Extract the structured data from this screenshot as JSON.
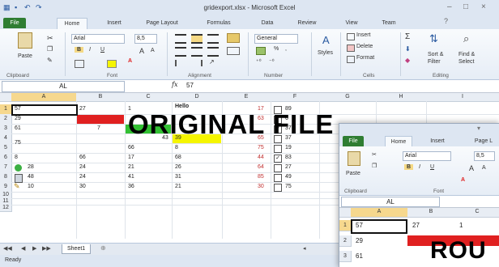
{
  "window": {
    "title": "gridexport.xlsx - Microsoft Excel",
    "qat": [
      "save-icon",
      "undo-icon",
      "redo-icon"
    ],
    "controls": [
      "–",
      "□",
      "×"
    ]
  },
  "tabs": [
    {
      "label": "File"
    },
    {
      "label": "Home"
    },
    {
      "label": "Insert"
    },
    {
      "label": "Page Layout"
    },
    {
      "label": "Formulas"
    },
    {
      "label": "Data"
    },
    {
      "label": "Review"
    },
    {
      "label": "View"
    },
    {
      "label": "Team"
    }
  ],
  "ribbon": {
    "clipboard": {
      "paste": "Paste",
      "label": "Clipboard"
    },
    "font": {
      "name": "Arial",
      "size": "8,5",
      "label": "Font",
      "bold": "B",
      "italic": "I",
      "underline": "U",
      "grow": "A",
      "shrink": "A"
    },
    "alignment": {
      "label": "Alignment"
    },
    "number": {
      "format": "General",
      "label": "Number",
      "pct": "%",
      "comma": ","
    },
    "styles": {
      "label": "Styles"
    },
    "cells": {
      "insert": "Insert",
      "delete": "Delete",
      "format": "Format",
      "label": "Cells"
    },
    "editing": {
      "sum": "Σ",
      "sort": "Sort &",
      "sort2": "Filter",
      "find": "Find &",
      "find2": "Select",
      "label": "Editing"
    }
  },
  "formula_bar": {
    "name_box": "AL",
    "fx": "fx",
    "value": "57"
  },
  "columns": [
    "A",
    "B",
    "C",
    "D",
    "E",
    "F",
    "G",
    "H",
    "I"
  ],
  "rows": [
    "1",
    "2",
    "3",
    "4",
    "5",
    "6",
    "7",
    "8",
    "9",
    "10",
    "11",
    "12"
  ],
  "cells": {
    "r1": {
      "a": "57",
      "b": "27",
      "c": "1",
      "d": "Hello",
      "e": "",
      "f_num": "17",
      "f_chk": "",
      "f_val": "89"
    },
    "r2": {
      "a": "29",
      "b": "",
      "c": "",
      "d": "",
      "f_num": "63",
      "f_val": "6"
    },
    "r3": {
      "a": "61",
      "b": "7",
      "c": "",
      "d": "",
      "f_num": "",
      "f_val": "37"
    },
    "r4": {
      "a": "75",
      "c": "43",
      "d": "39",
      "f_num": "65",
      "f_val": "37"
    },
    "r5": {
      "c": "66",
      "d": "8",
      "f_num": "75",
      "f_val": "19"
    },
    "r6": {
      "a": "8",
      "b": "66",
      "c": "17",
      "d": "68",
      "f_num": "44",
      "f_val": "83"
    },
    "r7": {
      "a": "28",
      "b": "24",
      "c": "21",
      "d": "26",
      "f_num": "64",
      "f_val": "27"
    },
    "r8": {
      "a": "48",
      "b": "24",
      "c": "41",
      "d": "31",
      "f_num": "85",
      "f_val": "49"
    },
    "r9": {
      "a": "10",
      "b": "30",
      "c": "36",
      "d": "21",
      "f_num": "30",
      "f_val": "75"
    }
  },
  "sheet_tabs": {
    "name": "Sheet1"
  },
  "status": {
    "text": "Ready"
  },
  "banner": {
    "text": "ORIGINAL FILE",
    "text2": "ROU"
  },
  "overlay": {
    "tabs": [
      "File",
      "Home",
      "Insert",
      "Page L"
    ],
    "font_name": "Arial",
    "font_size": "8,5",
    "paste": "Paste",
    "font_label": "Font",
    "clipboard_label": "Clipboard",
    "name_box": "AL",
    "columns": [
      "A",
      "B",
      "C"
    ],
    "rows": [
      "1",
      "2",
      "3"
    ],
    "cells": [
      [
        "57",
        "27",
        "1"
      ],
      [
        "29",
        "",
        ""
      ],
      [
        "61",
        "",
        ""
      ]
    ]
  },
  "colors": {
    "file_green": "#2f7d32",
    "red": "#e02020",
    "green": "#33c033",
    "yellow": "#f5f500",
    "select": "#f6d88e"
  }
}
